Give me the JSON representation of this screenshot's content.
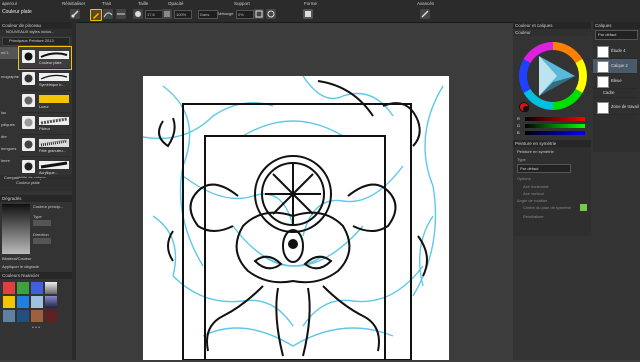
{
  "toolbar": {
    "tool_name": "Couleur plate",
    "tool_prefix": "apercu!",
    "reinit_label": "Réinitialiser",
    "stroke_label": "Trait",
    "size_label": "Taille",
    "opacity_label": "Opacité",
    "support_label": "Support",
    "shape_label": "Forme",
    "advanced_label": "Avancés",
    "size_value": "17.6",
    "opacity_value": "100%",
    "normal_value": "Dans",
    "mixing_label": "Mélange",
    "mixing_value": "0%"
  },
  "left": {
    "brush_panel_title": "Couleur de pinceau",
    "brush_set": "NOUVEAUX styles inclus...",
    "brush_group": "Principaux Peinture 2013",
    "categories": [
      "nd 1",
      "",
      "mographe",
      "",
      "",
      "lus",
      "ydiques",
      "dre",
      "hengues",
      "lenre",
      "ahat"
    ],
    "brushes": [
      {
        "name": "Couleur plate"
      },
      {
        "name": "Symétrique b..."
      },
      {
        "name": "Lueur"
      },
      {
        "name": "Pâleur"
      },
      {
        "name": "Pâte granuleu..."
      },
      {
        "name": "Acrylique..."
      }
    ],
    "compat_label": "Compatibilité de calque",
    "compat_value": "Couleur plate",
    "gradient_title": "Dégradés",
    "gradient_main": "Couleur princip...",
    "gradient_type": "Type",
    "gradient_dir": "Direction",
    "blend_label": "Bilatéral/Couleur",
    "apply_label": "Appliquer le dégradé",
    "palette_title": "Couleurs Nuancier",
    "dots": "• • •"
  },
  "right": {
    "color_panel_title": "Couleur et calques",
    "color_tab": "Couleur",
    "rgb_labels": [
      "R",
      "G",
      "B"
    ],
    "layers_title": "Calques",
    "blend_mode": "Par défaut",
    "layers": [
      {
        "name": "Étude 4"
      },
      {
        "name": "Calque 2"
      },
      {
        "name": "Bleue"
      },
      {
        "name": "Cadre"
      },
      {
        "name": "Zone de travail"
      }
    ],
    "sym_title": "Peinture en symétrie",
    "sym_enable": "Peinture en symétrie",
    "sym_type_label": "Type",
    "sym_type_value": "Par défaut",
    "sym_options": "Options",
    "sym_h": "Axe horizontal",
    "sym_v": "Axe vertical",
    "sym_angle": "Angle de rotation",
    "sym_center": "Centre du plan de symétrie",
    "sym_reset": "Réinitialiser"
  },
  "colors": {
    "accent": "#f5c400",
    "sketch_blue": "#5fc8e6",
    "ink": "#111111"
  }
}
